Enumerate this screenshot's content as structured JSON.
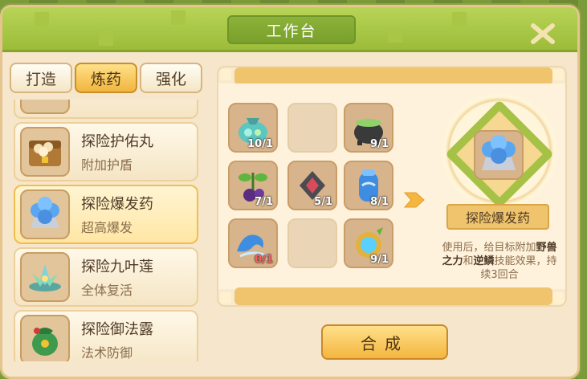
{
  "window": {
    "title": "工作台"
  },
  "tabs": [
    {
      "label": "打造",
      "active": false
    },
    {
      "label": "炼药",
      "active": true
    },
    {
      "label": "强化",
      "active": false
    }
  ],
  "recipes": [
    {
      "name": "探险护佑丸",
      "desc": "附加护盾",
      "icon": "treasure-chest-icon"
    },
    {
      "name": "探险爆发药",
      "desc": "超高爆发",
      "icon": "blue-orb-cluster-icon",
      "selected": true
    },
    {
      "name": "探险九叶莲",
      "desc": "全体复活",
      "icon": "lotus-icon"
    },
    {
      "name": "探险御法露",
      "desc": "法术防御",
      "icon": "green-pouch-icon"
    }
  ],
  "ingredients": [
    {
      "count": "10/1",
      "icon": "crystal-bag-icon"
    },
    {
      "count": "",
      "icon": "empty-slot"
    },
    {
      "count": "9/1",
      "icon": "cauldron-icon"
    },
    {
      "count": "7/1",
      "icon": "purple-berry-icon"
    },
    {
      "count": "5/1",
      "icon": "dark-crystal-icon"
    },
    {
      "count": "8/1",
      "icon": "blue-jar-icon"
    },
    {
      "count": "0/1",
      "icon": "wave-icon",
      "insufficient": true
    },
    {
      "count": "",
      "icon": "empty-slot"
    },
    {
      "count": "9/1",
      "icon": "gold-ring-icon"
    }
  ],
  "result": {
    "name": "探险爆发药",
    "effect_prefix": "使用后，给目标附加",
    "effect_bold_1": "野兽之力",
    "effect_mid": "和",
    "effect_bold_2": "逆鳞",
    "effect_suffix": "技能效果，持续3回合"
  },
  "craft_button": {
    "label": "合成"
  },
  "colors": {
    "accent_green": "#9cbc39",
    "accent_orange": "#f4b63e",
    "insufficient_red": "#ff5a5a"
  }
}
